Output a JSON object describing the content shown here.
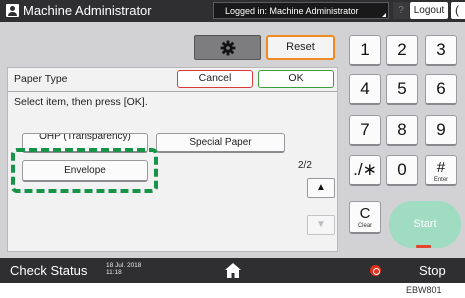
{
  "topbar": {
    "title": "Machine Administrator",
    "login_status": "Logged in: Machine Administrator",
    "help_label": "?",
    "logout_label": "Logout",
    "back_label": "("
  },
  "toolbar": {
    "settings_icon": "gear-icon",
    "reset_label": "Reset"
  },
  "dialog": {
    "title": "Paper Type",
    "cancel_label": "Cancel",
    "ok_label": "OK",
    "instruction": "Select item, then press [OK].",
    "options": {
      "ohp": "OHP (Transparency)",
      "special": "Special Paper",
      "envelope": "Envelope"
    },
    "page_indicator": "2/2",
    "scroll_up": "▲",
    "scroll_down": "▼"
  },
  "keypad": {
    "k1": "1",
    "k2": "2",
    "k3": "3",
    "k4": "4",
    "k5": "5",
    "k6": "6",
    "k7": "7",
    "k8": "8",
    "k9": "9",
    "kstar": "./∗",
    "k0": "0",
    "khash": "#",
    "khash_sub": "Enter",
    "kclear": "C",
    "kclear_sub": "Clear",
    "start_label": "Start"
  },
  "bottombar": {
    "check_status": "Check Status",
    "date": "18 Jul. 2018",
    "time": "11:18",
    "home_icon": "home-icon",
    "stop_label": "Stop"
  },
  "figure_id": "EBW801",
  "colors": {
    "highlight": "#179447",
    "reset_border": "#f08a22",
    "cancel_border": "#d83a3a",
    "ok_border": "#3b9e3b",
    "start": "#9fdcc2",
    "stop": "#e0301e"
  }
}
